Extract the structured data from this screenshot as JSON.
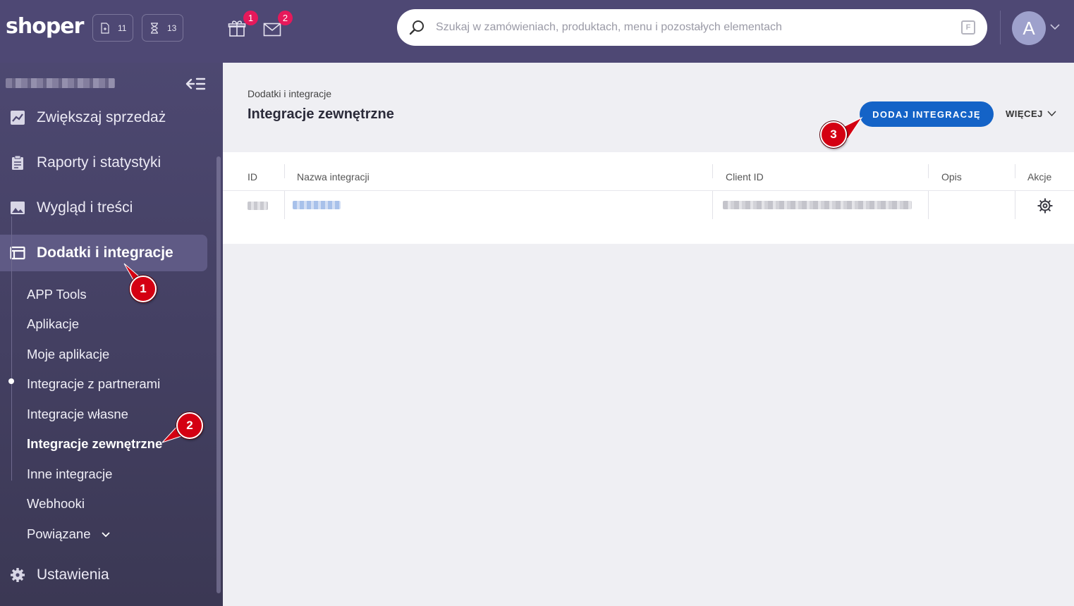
{
  "topbar": {
    "logo": "shoper",
    "counters": [
      {
        "icon": "document-icon",
        "value": "11"
      },
      {
        "icon": "hourglass-icon",
        "value": "13"
      }
    ],
    "gift_badge": "1",
    "mail_badge": "2",
    "search_placeholder": "Szukaj w zamówieniach, produktach, menu i pozostałych elementach",
    "avatar_letter": "A"
  },
  "sidebar": {
    "nav": [
      {
        "label": "Zwiększaj sprzedaż",
        "icon": "chart-icon"
      },
      {
        "label": "Raporty i statystyki",
        "icon": "clipboard-icon"
      },
      {
        "label": "Wygląd i treści",
        "icon": "image-icon"
      },
      {
        "label": "Dodatki i integracje",
        "icon": "window-icon",
        "active": true
      },
      {
        "label": "Ustawienia",
        "icon": "gear-icon"
      }
    ],
    "subitems": [
      "APP Tools",
      "Aplikacje",
      "Moje aplikacje",
      "Integracje z partnerami",
      "Integracje własne",
      "Integracje zewnętrzne",
      "Inne integracje",
      "Webhooki",
      "Powiązane"
    ],
    "current_subitem": "Integracje zewnętrzne"
  },
  "main": {
    "breadcrumb": "Dodatki i integracje",
    "title": "Integracje zewnętrzne",
    "add_button": "DODAJ INTEGRACJĘ",
    "more_button": "WIĘCEJ",
    "table": {
      "columns": [
        "ID",
        "Nazwa integracji",
        "Client ID",
        "Opis",
        "Akcje"
      ]
    }
  },
  "markers": [
    "1",
    "2",
    "3"
  ],
  "colors": {
    "topbar": "#4e4874",
    "sidebar": "#4d4871",
    "accent": "#1463c7",
    "badge": "#e6195b",
    "marker": "#d40012"
  }
}
